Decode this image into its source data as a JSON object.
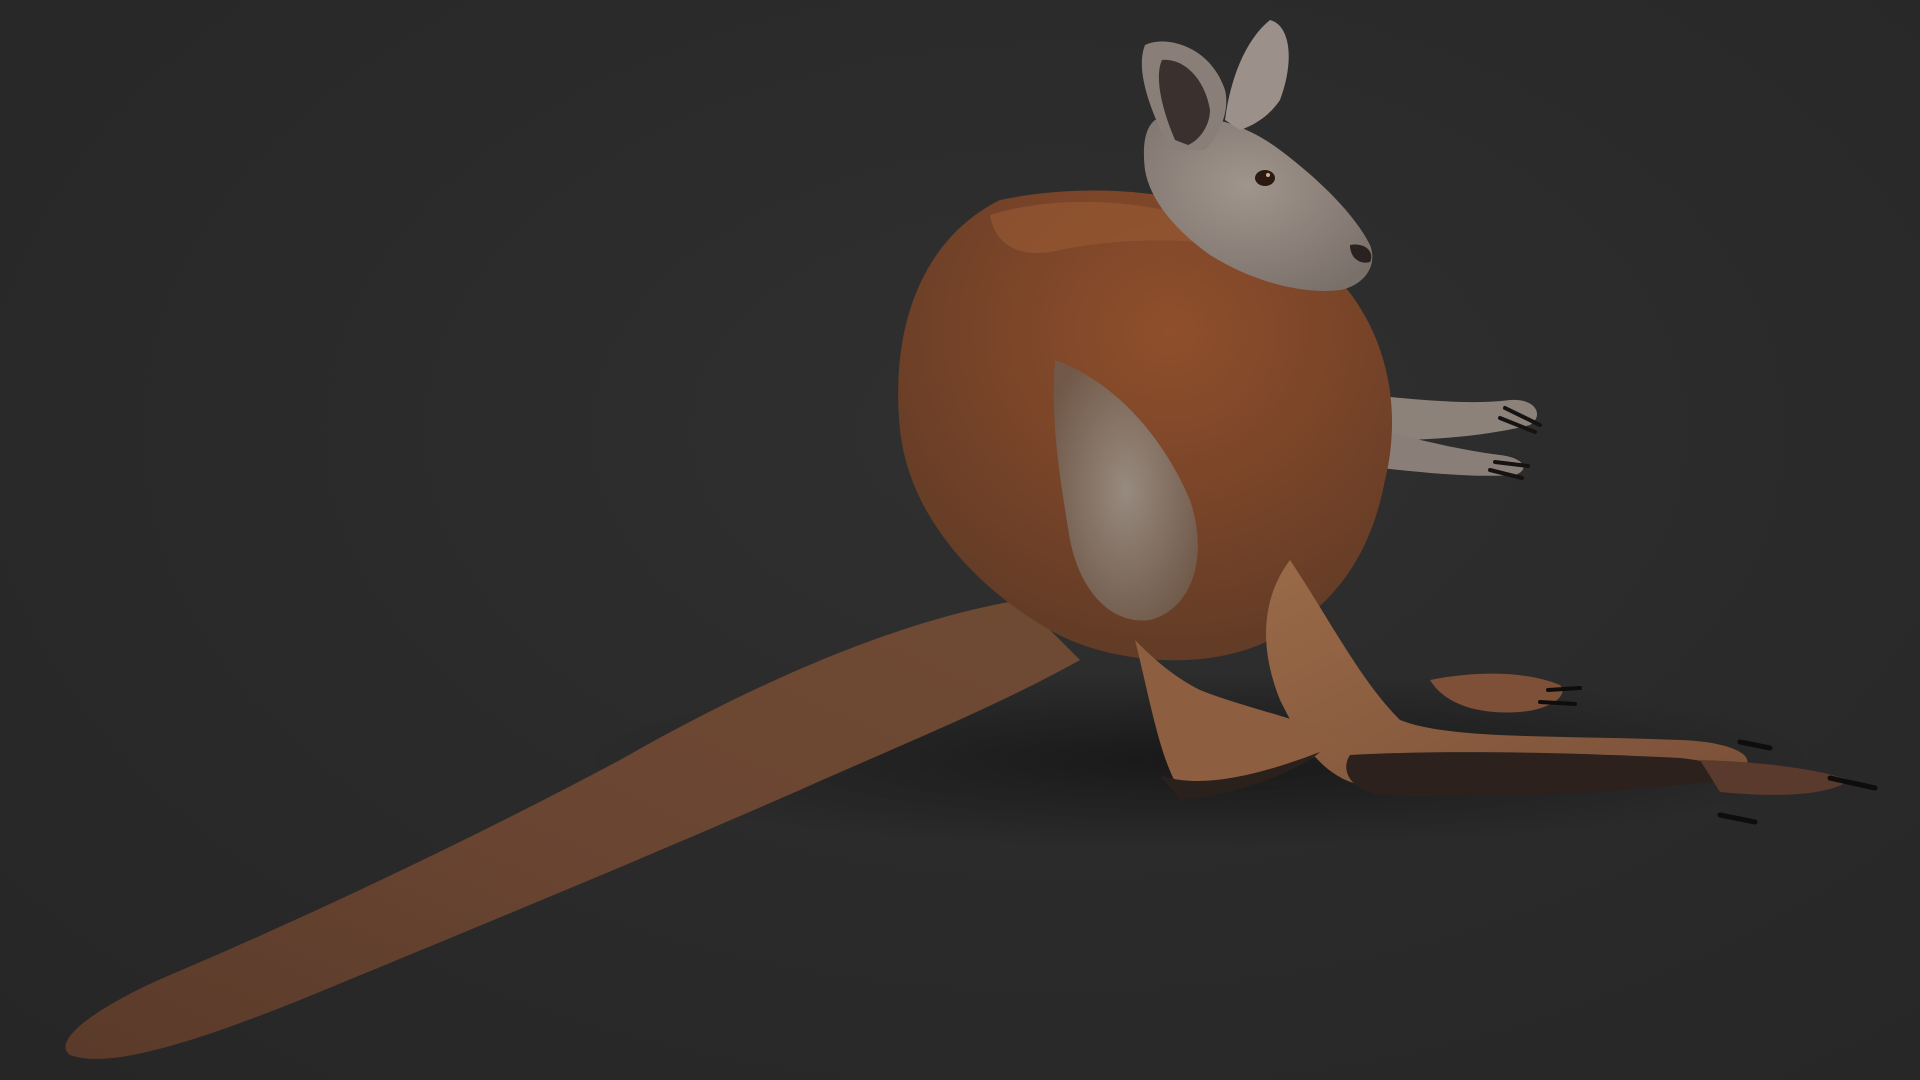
{
  "scene": {
    "background_color": "#2b2b2b",
    "subject": "kangaroo-render",
    "colors": {
      "fur_main": "#7a4a2c",
      "fur_back": "#8a4e2c",
      "fur_belly": "#8f8a84",
      "head_grey": "#8d8580",
      "foot_pad": "#2a1f1c",
      "claw": "#121010"
    }
  }
}
